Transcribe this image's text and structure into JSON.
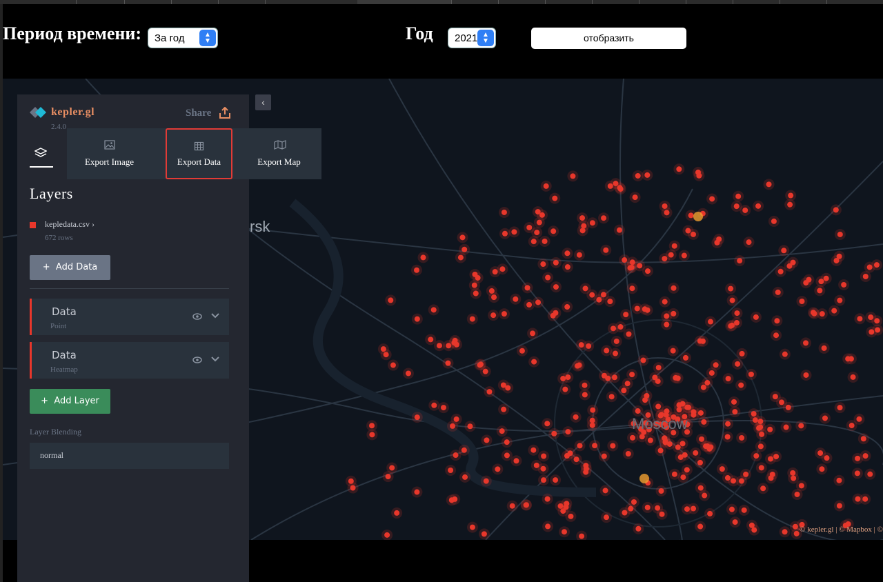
{
  "filters": {
    "period_label": "Период времени:",
    "period_value": "За год",
    "year_label": "Год",
    "year_value": "2021",
    "show_button": "отобразить"
  },
  "sidebar": {
    "app_name": "kepler.gl",
    "version": "2.4.0",
    "share_label": "Share",
    "section_title": "Layers",
    "dataset": {
      "name": "kepledata.csv",
      "rows": "672 rows",
      "color": "#e8372b"
    },
    "add_data": "Add Data",
    "add_data_plus": "+",
    "layers": [
      {
        "name": "Data",
        "type": "Point"
      },
      {
        "name": "Data",
        "type": "Heatmap"
      }
    ],
    "add_layer": "Add Layer",
    "add_layer_plus": "+",
    "blending_label": "Layer Blending",
    "blending_value": "normal"
  },
  "export_menu": {
    "items": [
      {
        "label": "Export Image",
        "icon": "image-icon"
      },
      {
        "label": "Export Data",
        "icon": "table-icon",
        "highlighted": true
      },
      {
        "label": "Export Map",
        "icon": "map-icon"
      }
    ]
  },
  "map": {
    "labels": {
      "city": "Moscow",
      "partial": "rsk"
    },
    "attribution": "© kepler.gl | © Mapbox | ©",
    "point_color": "#e8372b",
    "background": "#0f151e"
  },
  "colors": {
    "accent": "#e88e63",
    "highlight_border": "#e23b36",
    "add_layer_green": "#3a8c5a"
  }
}
